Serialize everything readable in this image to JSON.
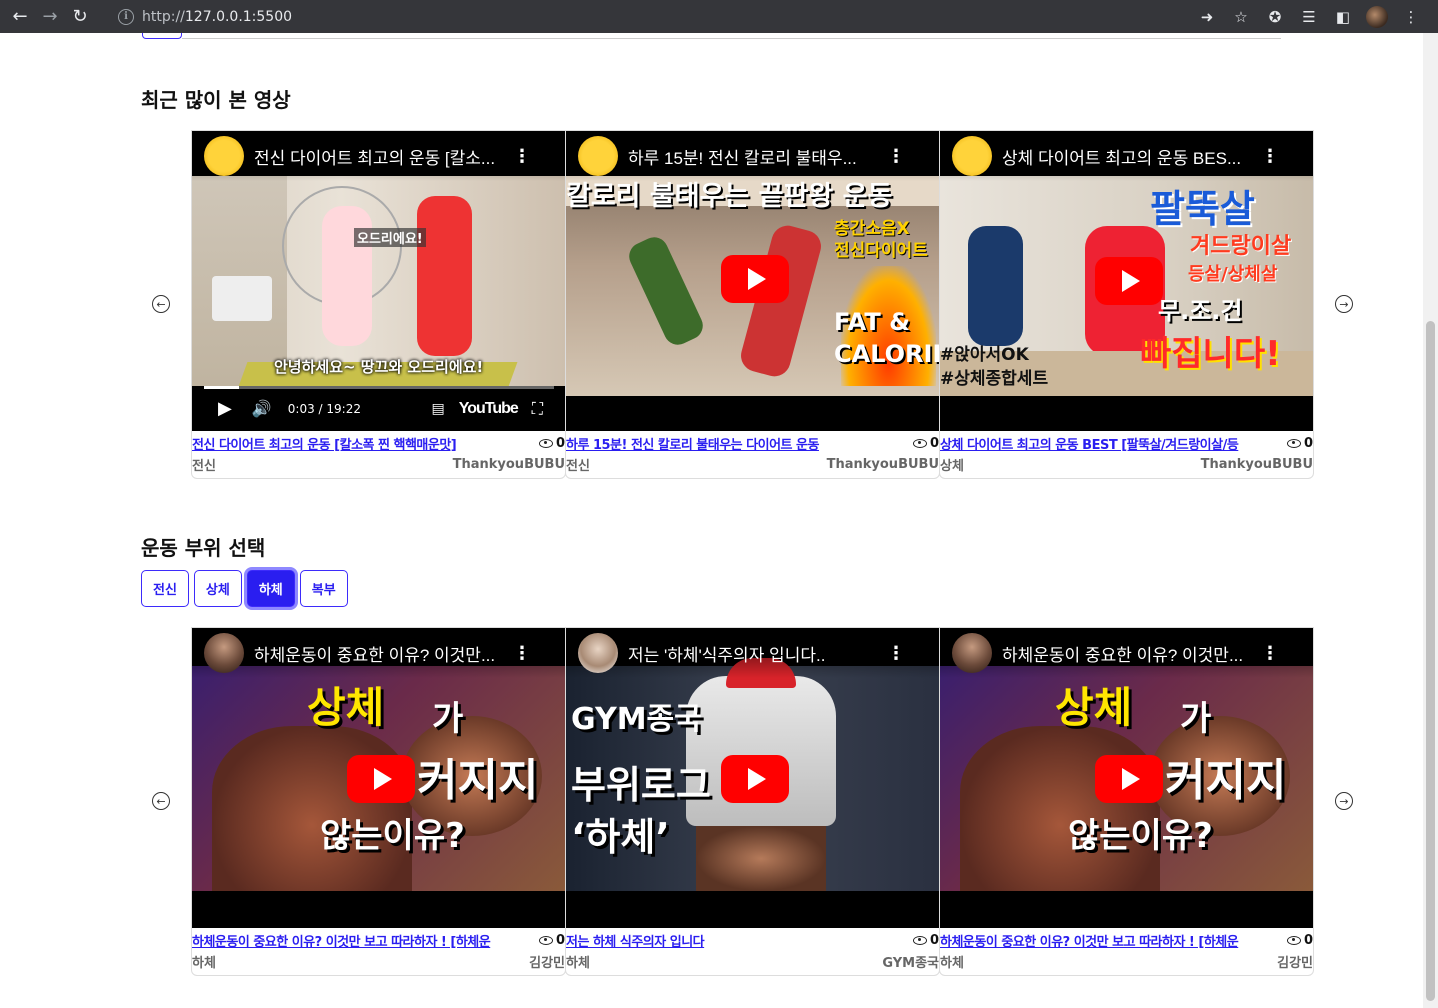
{
  "browser": {
    "url_scheme": "http://",
    "url_host": "127.0.0.1:5500"
  },
  "sections": {
    "popular_title": "최근 많이 본 영상",
    "part_title": "운동 부위 선택"
  },
  "part_buttons": [
    "전신",
    "상체",
    "하체",
    "복부"
  ],
  "active_part": "하체",
  "popular_videos": [
    {
      "player_title": "전신 다이어트 최고의 운동 [칼소...",
      "link": "전신 다이어트 최고의 운동 [칼소폭 찐 핵핵매운맛]",
      "views": "0",
      "category": "전신",
      "channel": "ThankyouBUBU",
      "overlay1": "오드리에요!",
      "overlay2": "안녕하세요~ 땅끄와 오드리에요!",
      "time": "0:03 / 19:22",
      "yt": "YouTube"
    },
    {
      "player_title": "하루 15분! 전신 칼로리 불태우...",
      "link": "하루 15분! 전신 칼로리 불태우는 다이어트 운동",
      "views": "0",
      "category": "전신",
      "channel": "ThankyouBUBU",
      "overlay1": "칼로리 불태우는 끝판왕 운동",
      "overlay2": "층간소음X",
      "overlay3": "전신다이어트",
      "overlay4": "FAT & CALORIE"
    },
    {
      "player_title": "상체 다이어트 최고의 운동 BES...",
      "link": "상체 다이어트 최고의 운동 BEST [팔뚝살/겨드랑이살/등",
      "views": "0",
      "category": "상체",
      "channel": "ThankyouBUBU",
      "overlay1": "팔뚝살",
      "overlay2": "겨드랑이살",
      "overlay3": "등살/상체살",
      "overlay4": "무.조.건",
      "overlay5": "빠집니다!",
      "overlay6": "#앉아서OK",
      "overlay7": "#상체종합세트"
    }
  ],
  "part_videos": [
    {
      "player_title": "하체운동이 중요한 이유? 이것만...",
      "link": "하체운동이 중요한 이유? 이것만 보고 따라하자 ! [하체운",
      "views": "0",
      "category": "하체",
      "channel": "김강민",
      "overlay1": "상체",
      "overlay2": "가",
      "overlay3": "커지지",
      "overlay4": "않는이유?"
    },
    {
      "player_title": "저는 '하체'식주의자 입니다..",
      "link": "저는 하체 식주의자 입니다",
      "views": "0",
      "category": "하체",
      "channel": "GYM종국",
      "overlay1": "GYM종국",
      "overlay2": "부위로그",
      "overlay3": "‘하체’"
    },
    {
      "player_title": "하체운동이 중요한 이유? 이것만...",
      "link": "하체운동이 중요한 이유? 이것만 보고 따라하자 ! [하체운",
      "views": "0",
      "category": "하체",
      "channel": "김강민",
      "overlay1": "상체",
      "overlay2": "가",
      "overlay3": "커지지",
      "overlay4": "않는이유?"
    }
  ],
  "colors": {
    "accent": "#2a1ef0",
    "youtube_red": "#ff0000"
  }
}
